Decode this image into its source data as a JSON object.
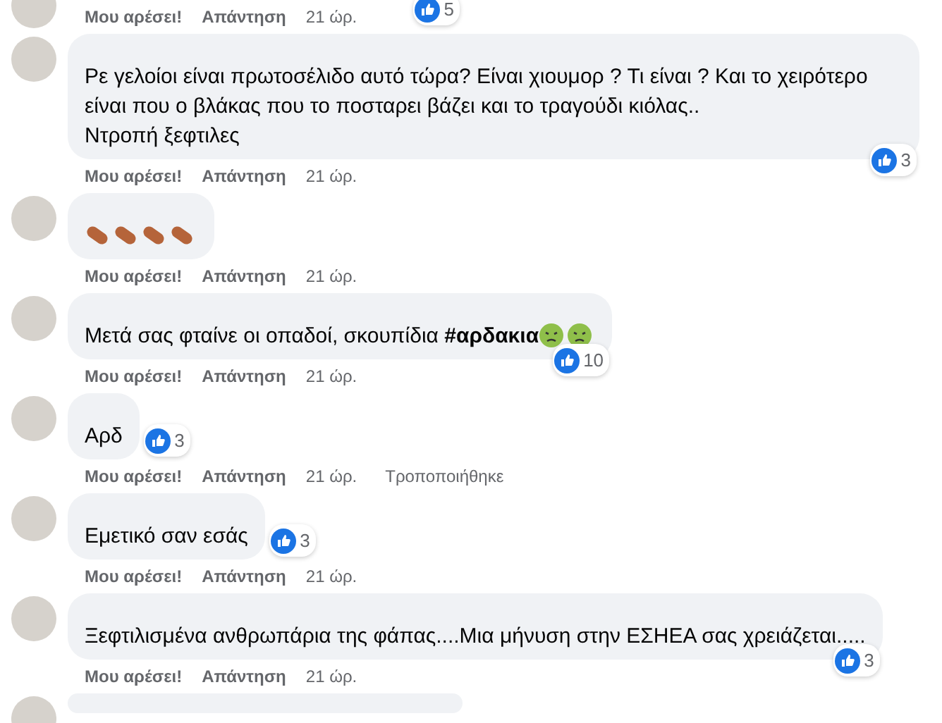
{
  "comments": [
    {
      "reactions": {
        "count": "5"
      },
      "actions": {
        "like": "Μου αρέσει!",
        "reply": "Απάντηση",
        "time": "21 ώρ."
      }
    },
    {
      "body": [
        {
          "kind": "text",
          "text": "Ρε γελοίοι είναι πρωτοσέλιδο αυτό τώρα? Είναι χιουμορ ? Τι είναι ? Και το χειρότερο είναι που ο βλάκας που το ποσταρει βάζει και το τραγούδι κιόλας.."
        },
        {
          "kind": "break"
        },
        {
          "kind": "text",
          "text": "Ντροπή ξεφτιλες"
        }
      ],
      "reactions": {
        "count": "3"
      },
      "actions": {
        "like": "Μου αρέσει!",
        "reply": "Απάντηση",
        "time": "21 ώρ."
      }
    },
    {
      "body": [
        {
          "kind": "capsule"
        },
        {
          "kind": "capsule"
        },
        {
          "kind": "capsule"
        },
        {
          "kind": "capsule"
        }
      ],
      "actions": {
        "like": "Μου αρέσει!",
        "reply": "Απάντηση",
        "time": "21 ώρ."
      }
    },
    {
      "body": [
        {
          "kind": "text",
          "text": "Μετά σας φταίνε οι οπαδοί, σκουπίδια "
        },
        {
          "kind": "tag",
          "text": "#αρδακια"
        },
        {
          "kind": "sick"
        },
        {
          "kind": "sick"
        }
      ],
      "reactions": {
        "count": "10"
      },
      "actions": {
        "like": "Μου αρέσει!",
        "reply": "Απάντηση",
        "time": "21 ώρ."
      }
    },
    {
      "body": [
        {
          "kind": "text",
          "text": "Αρδ"
        }
      ],
      "reactions": {
        "count": "3"
      },
      "actions": {
        "like": "Μου αρέσει!",
        "reply": "Απάντηση",
        "time": "21 ώρ.",
        "edited": "Τροποποιήθηκε"
      }
    },
    {
      "body": [
        {
          "kind": "text",
          "text": "Εμετικό σαν εσάς"
        }
      ],
      "reactions": {
        "count": "3"
      },
      "actions": {
        "like": "Μου αρέσει!",
        "reply": "Απάντηση",
        "time": "21 ώρ."
      }
    },
    {
      "body": [
        {
          "kind": "text",
          "text": "Ξεφτιλισμένα ανθρωπάρια της φάπας....Μια μήνυση στην ΕΣΗΕΑ σας χρειάζεται....."
        }
      ],
      "reactions": {
        "count": "3"
      },
      "actions": {
        "like": "Μου αρέσει!",
        "reply": "Απάντηση",
        "time": "21 ώρ."
      }
    }
  ]
}
